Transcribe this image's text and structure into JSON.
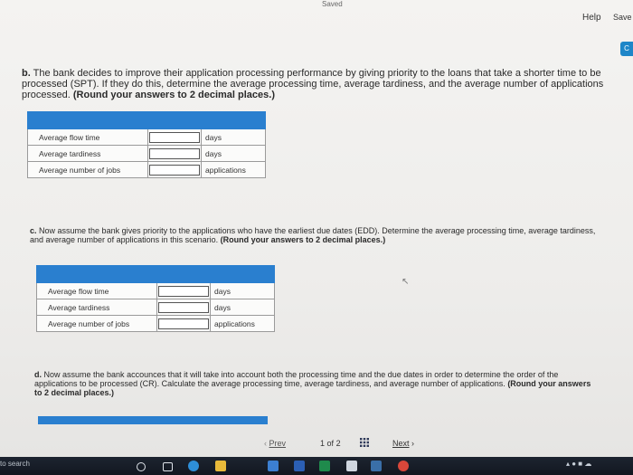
{
  "header": {
    "saved": "Saved",
    "help": "Help",
    "save": "Save",
    "side_button": "C"
  },
  "question_b": {
    "letter": "b.",
    "text": "The bank decides to improve their application processing performance by giving priority to the loans that take a shorter time to be processed (SPT). If they do this, determine the average processing time, average tardiness, and the average number of applications processed.",
    "emphasis": "(Round your answers to 2 decimal places.)",
    "rows": [
      {
        "label": "Average flow time",
        "value": "",
        "unit": "days"
      },
      {
        "label": "Average tardiness",
        "value": "",
        "unit": "days"
      },
      {
        "label": "Average number of jobs",
        "value": "",
        "unit": "applications"
      }
    ]
  },
  "question_c": {
    "letter": "c.",
    "text": "Now assume the bank gives priority to the applications who have the earliest due dates (EDD). Determine the average processing time, average tardiness, and average number of applications in this scenario.",
    "emphasis": "(Round your answers to 2 decimal places.)",
    "rows": [
      {
        "label": "Average flow time",
        "value": "",
        "unit": "days"
      },
      {
        "label": "Average tardiness",
        "value": "",
        "unit": "days"
      },
      {
        "label": "Average number of jobs",
        "value": "",
        "unit": "applications"
      }
    ]
  },
  "question_d": {
    "letter": "d.",
    "text": "Now assume the bank accounces that it will take into account both the processing time and the due dates in order to determine the order of the applications to be processed (CR). Calculate the average processing time, average tardiness, and average number of applications.",
    "emphasis": "(Round your answers to 2 decimal places.)"
  },
  "pager": {
    "prev": "Prev",
    "current": "1",
    "of": "of",
    "total": "2",
    "next": "Next"
  },
  "taskbar": {
    "search": "to search"
  },
  "colors": {
    "accent": "#2a7fcf"
  }
}
